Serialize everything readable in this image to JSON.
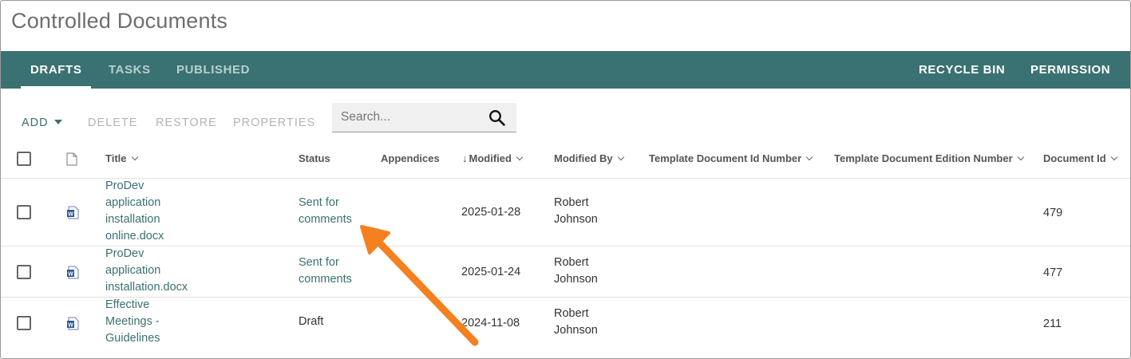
{
  "page": {
    "title": "Controlled Documents"
  },
  "tabs": {
    "left": [
      {
        "label": "DRAFTS",
        "active": true
      },
      {
        "label": "TASKS",
        "active": false
      },
      {
        "label": "PUBLISHED",
        "active": false
      }
    ],
    "right": [
      {
        "label": "RECYCLE BIN"
      },
      {
        "label": "PERMISSION"
      }
    ]
  },
  "toolbar": {
    "add_label": "ADD",
    "delete_label": "DELETE",
    "restore_label": "RESTORE",
    "properties_label": "PROPERTIES"
  },
  "search": {
    "placeholder": "Search..."
  },
  "table": {
    "columns": {
      "title": "Title",
      "status": "Status",
      "appendices": "Appendices",
      "modified": "Modified",
      "modified_by": "Modified By",
      "template_doc_id": "Template Document Id Number",
      "template_doc_edition": "Template Document Edition Number",
      "document_id": "Document Id"
    },
    "sort": {
      "column": "modified",
      "direction": "descending",
      "icon": "arrow-down-icon"
    },
    "rows": [
      {
        "title": [
          "ProDev",
          "application",
          "installation",
          "online.docx"
        ],
        "status": [
          "Sent for",
          "comments"
        ],
        "status_is_link": true,
        "modified": "2025-01-28",
        "modified_by": [
          "Robert",
          "Johnson"
        ],
        "document_id": "479",
        "file_icon": "word-icon"
      },
      {
        "title": [
          "ProDev",
          "application",
          "installation.docx"
        ],
        "status": [
          "Sent for",
          "comments"
        ],
        "status_is_link": true,
        "modified": "2025-01-24",
        "modified_by": [
          "Robert",
          "Johnson"
        ],
        "document_id": "477",
        "file_icon": "word-icon"
      },
      {
        "title": [
          "Effective",
          "Meetings -",
          "Guidelines"
        ],
        "status": [
          "Draft"
        ],
        "status_is_link": false,
        "modified": "2024-11-08",
        "modified_by": [
          "Robert",
          "Johnson"
        ],
        "document_id": "211",
        "file_icon": "word-icon"
      }
    ]
  },
  "colors": {
    "accent": "#3a7172",
    "annotation_arrow": "#f5801f",
    "disabled_text": "#b4b4b4"
  },
  "annotation": {
    "type": "arrow",
    "points_to": "status of first row"
  }
}
